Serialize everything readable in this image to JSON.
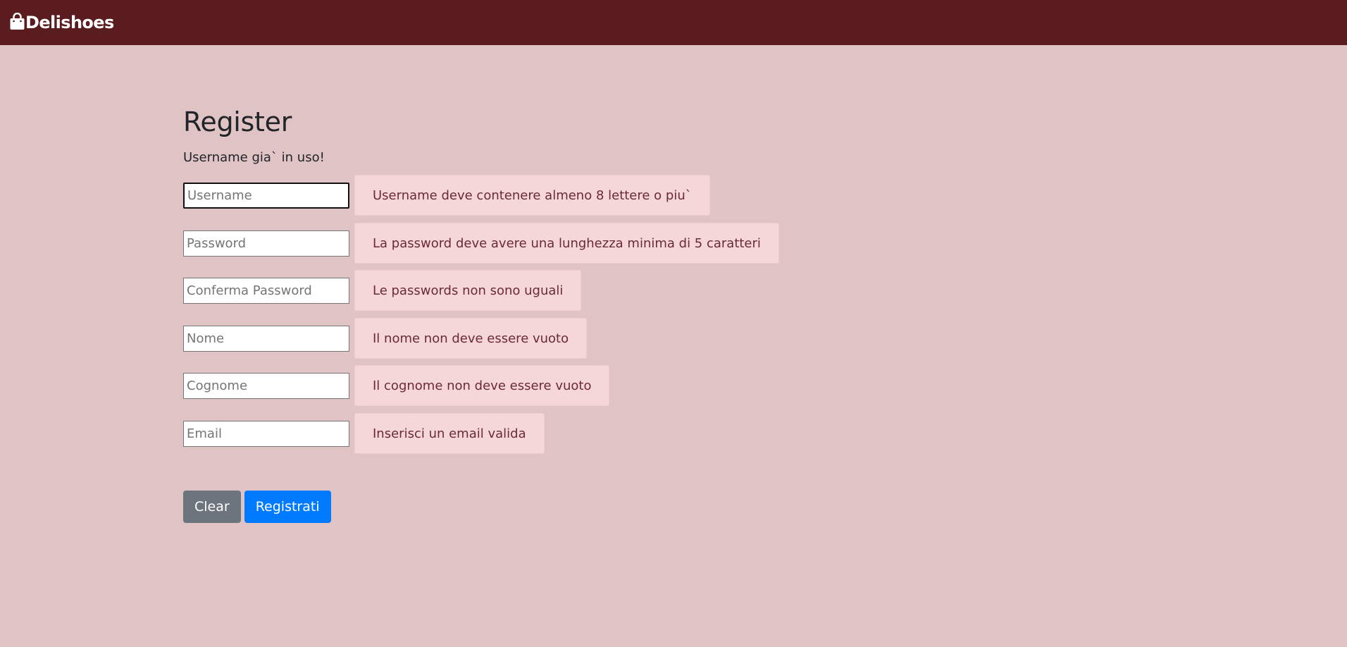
{
  "navbar": {
    "brand": "Delishoes",
    "brand_icon": "shopping-bag-icon"
  },
  "form": {
    "title": "Register",
    "error": "Username gia` in uso!",
    "fields": [
      {
        "placeholder": "Username",
        "value": "",
        "hint": "Username deve contenere almeno 8 lettere o piu`"
      },
      {
        "placeholder": "Password",
        "value": "",
        "hint": "La password deve avere una lunghezza minima di 5 caratteri"
      },
      {
        "placeholder": "Conferma Password",
        "value": "",
        "hint": "Le passwords non sono uguali"
      },
      {
        "placeholder": "Nome",
        "value": "",
        "hint": "Il nome non deve essere vuoto"
      },
      {
        "placeholder": "Cognome",
        "value": "",
        "hint": "Il cognome non deve essere vuoto"
      },
      {
        "placeholder": "Email",
        "value": "",
        "hint": "Inserisci un email valida"
      }
    ],
    "clear_label": "Clear",
    "submit_label": "Registrati"
  },
  "colors": {
    "navbar_bg": "#5a1c1f",
    "page_bg": "#e0c3c5",
    "hint_bg": "#f5d7d9",
    "hint_text": "#6b2a33",
    "clear_button": "#6c757d",
    "submit_button": "#007bff"
  }
}
